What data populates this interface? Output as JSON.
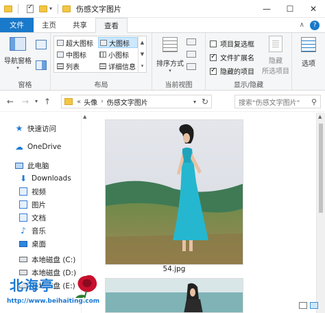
{
  "window": {
    "title": "伤感文字图片",
    "minimize": "—",
    "maximize": "☐",
    "close": "✕"
  },
  "tabs": {
    "file": "文件",
    "home": "主页",
    "share": "共享",
    "view": "查看",
    "help": "?"
  },
  "ribbon": {
    "panes": {
      "label": "窗格",
      "nav_pane": "导航窗格"
    },
    "layout": {
      "label": "布局",
      "items": [
        "超大图标",
        "大图标",
        "中图标",
        "小图标",
        "列表",
        "详细信息"
      ]
    },
    "current_view": {
      "label": "当前视图",
      "sort": "排序方式"
    },
    "show_hide": {
      "label": "显示/隐藏",
      "item_checkboxes": "项目复选框",
      "file_extensions": "文件扩展名",
      "hidden_items": "隐藏的项目",
      "hide_selected": "隐藏",
      "hide_selected_2": "所选项目"
    },
    "options": "选项"
  },
  "address": {
    "crumb_root": "头像",
    "crumb_current": "伤感文字图片",
    "search_placeholder": "搜索\"伤感文字图片\""
  },
  "nav": {
    "quick_access": "快速访问",
    "onedrive": "OneDrive",
    "this_pc": "此电脑",
    "downloads": "Downloads",
    "videos": "视频",
    "pictures": "图片",
    "documents": "文档",
    "music": "音乐",
    "desktop": "桌面",
    "disk_c": "本地磁盘 (C:)",
    "disk_d": "本地磁盘 (D:)",
    "disk_e": "本地磁盘 (E:)"
  },
  "files": [
    {
      "name": "54.jpg"
    }
  ],
  "watermark": {
    "brand": "北海亭",
    "url": "http://www.beihaiting.com"
  }
}
